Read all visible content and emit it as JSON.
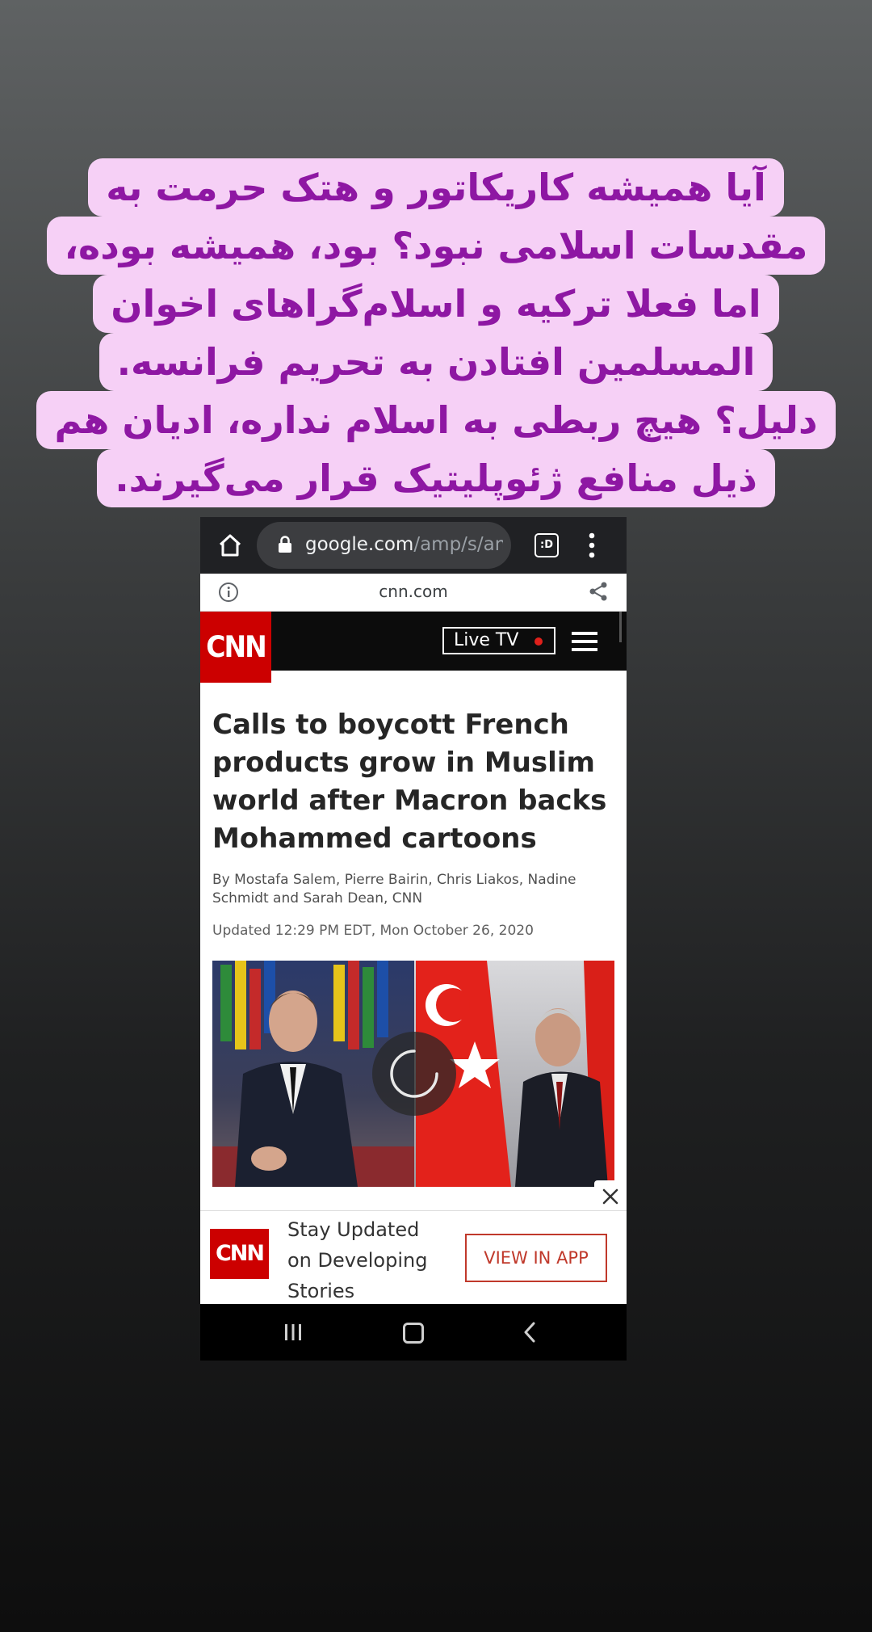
{
  "caption": {
    "lines": [
      "آیا همیشه کاریکاتور و هتک حرمت به",
      "مقدسات اسلامی نبود؟ بود، همیشه بوده،",
      "اما فعلا ترکیه و اسلام‌گراهای اخوان",
      "المسلمین افتادن به تحریم فرانسه.",
      "دلیل؟ هیچ ربطی به اسلام نداره، ادیان هم",
      "ذیل منافع ژئوپلیتیک قرار می‌گیرند."
    ],
    "text_color": "#8e17a3",
    "background_color": "#f6d0f6"
  },
  "browser": {
    "url_host": "google.com",
    "url_path": "/amp/s/am",
    "tab_switcher_label": ":D",
    "icons": [
      "home-icon",
      "lock-icon",
      "tab-switcher-icon",
      "menu-dots-icon"
    ]
  },
  "amp_bar": {
    "domain": "cnn.com",
    "icons": [
      "info-icon",
      "share-icon"
    ]
  },
  "cnn_header": {
    "logo": "CNN",
    "live_tv_label": "Live TV",
    "brand_color": "#cc0000",
    "live_dot_color": "#e0201b"
  },
  "article": {
    "headline": "Calls to boycott French products grow in Muslim world after Macron backs Mohammed cartoons",
    "byline": "By Mostafa Salem, Pierre Bairin, Chris Liakos, Nadine Schmidt and Sarah Dean, CNN",
    "updated": "Updated 12:29 PM EDT, Mon October 26, 2020"
  },
  "app_banner": {
    "logo": "CNN",
    "text": "Stay Updated on Developing Stories",
    "cta_label": "VIEW IN APP",
    "cta_color": "#c0392b"
  },
  "nav_bar": {
    "icons": [
      "recents-icon",
      "home-icon",
      "back-icon"
    ]
  }
}
